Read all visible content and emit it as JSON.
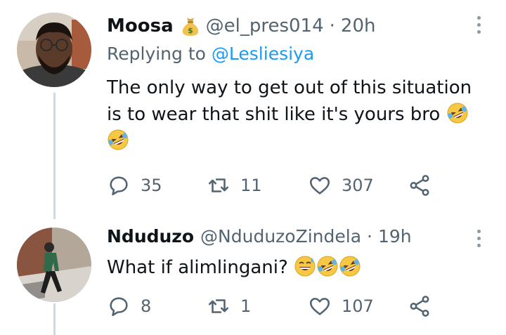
{
  "tweets": [
    {
      "display_name": "Moosa",
      "badge_icon": "money-bag-icon",
      "handle": "@el_pres014",
      "separator": "·",
      "time": "20h",
      "replying_prefix": "Replying to",
      "replying_to": "@Lesliesiya",
      "text": "The only way to get out of this situation is to wear that shit like it's yours bro",
      "emojis": [
        "rolling-laughing-emoji",
        "rolling-laughing-emoji"
      ],
      "replies": "35",
      "retweets": "11",
      "likes": "307"
    },
    {
      "display_name": "Nduduzo",
      "handle": "@NduduzoZindela",
      "separator": "·",
      "time": "19h",
      "text": "What if alimlingani?",
      "emojis": [
        "sweat-smile-emoji",
        "rolling-laughing-emoji",
        "rolling-laughing-emoji"
      ],
      "replies": "8",
      "retweets": "1",
      "likes": "107"
    }
  ],
  "colors": {
    "text": "#0f1419",
    "secondary": "#536471",
    "link": "#1d9bf0",
    "thread_line": "#cfd9de"
  }
}
